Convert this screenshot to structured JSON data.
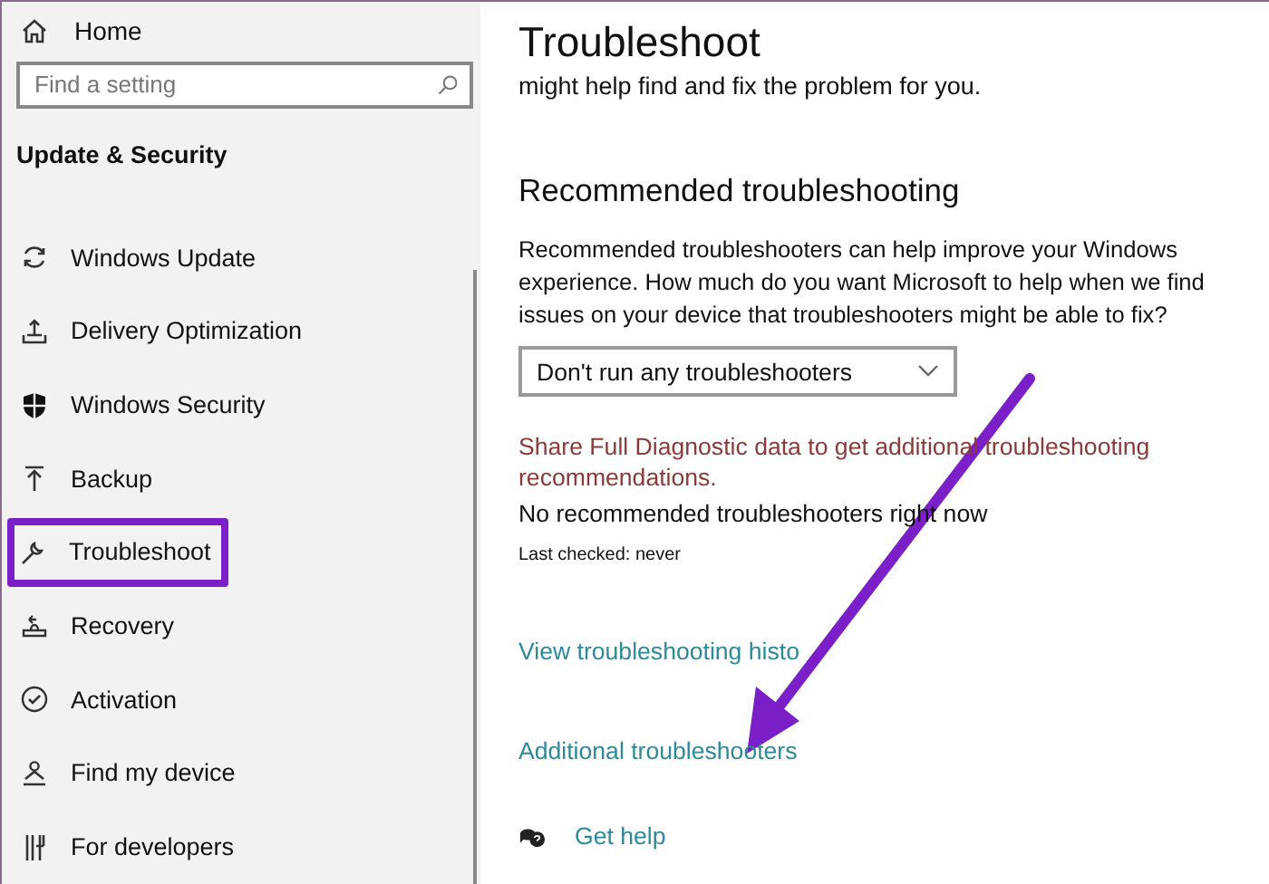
{
  "sidebar": {
    "home": "Home",
    "search": {
      "placeholder": "Find a setting"
    },
    "heading": "Update & Security",
    "items": [
      {
        "label": "Windows Update",
        "highlighted": false
      },
      {
        "label": "Delivery Optimization",
        "highlighted": false
      },
      {
        "label": "Windows Security",
        "highlighted": false
      },
      {
        "label": "Backup",
        "highlighted": false
      },
      {
        "label": "Troubleshoot",
        "highlighted": true
      },
      {
        "label": "Recovery",
        "highlighted": false
      },
      {
        "label": "Activation",
        "highlighted": false
      },
      {
        "label": "Find my device",
        "highlighted": false
      },
      {
        "label": "For developers",
        "highlighted": false
      }
    ]
  },
  "main": {
    "title": "Troubleshoot",
    "intro": "might help find and fix the problem for you.",
    "section_title": "Recommended troubleshooting",
    "description": "Recommended troubleshooters can help improve your Windows experience. How much do you want Microsoft to help when we find issues on your device that troubleshooters might be able to fix?",
    "dropdown": {
      "value": "Don't run any troubleshooters"
    },
    "warning": "Share Full Diagnostic data to get additional troubleshooting recommendations.",
    "status": "No recommended troubleshooters right now",
    "last_checked": "Last checked: never",
    "links": [
      "View troubleshooting histo",
      "Additional troubleshooters"
    ],
    "help": "Get help"
  }
}
